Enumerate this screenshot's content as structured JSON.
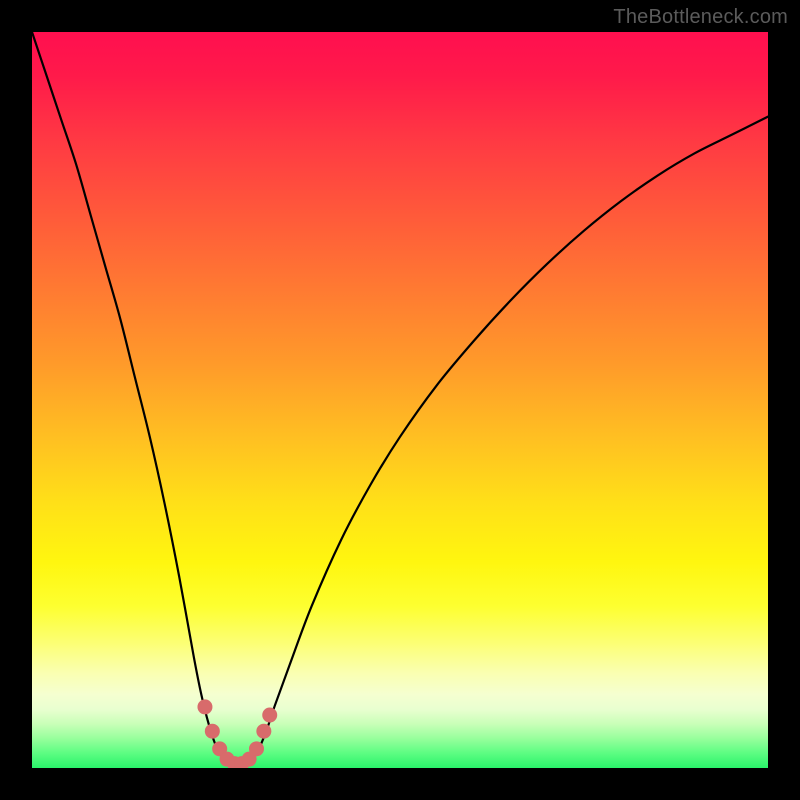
{
  "watermark": "TheBottleneck.com",
  "chart_data": {
    "type": "line",
    "title": "",
    "xlabel": "",
    "ylabel": "",
    "xlim": [
      0,
      100
    ],
    "ylim": [
      0,
      100
    ],
    "series": [
      {
        "name": "curve",
        "x": [
          0,
          2,
          4,
          6,
          8,
          10,
          12,
          14,
          16,
          18,
          20,
          22,
          23,
          24,
          25,
          26,
          27,
          28,
          29,
          30,
          31,
          32,
          33,
          35,
          38,
          42,
          46,
          50,
          55,
          60,
          65,
          70,
          75,
          80,
          85,
          90,
          95,
          100
        ],
        "y": [
          100,
          94,
          88,
          82,
          75,
          68,
          61,
          53,
          45,
          36,
          26,
          15,
          10,
          6,
          3,
          1.4,
          0.7,
          0.5,
          0.7,
          1.4,
          3,
          5.5,
          8.5,
          14,
          22,
          31,
          38.5,
          45,
          52,
          58,
          63.5,
          68.5,
          73,
          77,
          80.5,
          83.5,
          86,
          88.5
        ]
      }
    ],
    "markers": {
      "name": "dots",
      "color": "#d86b6b",
      "x": [
        23.5,
        24.5,
        25.5,
        26.5,
        27.5,
        28.5,
        29.5,
        30.5,
        31.5,
        32.3
      ],
      "y": [
        8.3,
        5.0,
        2.6,
        1.2,
        0.6,
        0.6,
        1.2,
        2.6,
        5.0,
        7.2
      ]
    },
    "background": {
      "type": "vertical-gradient",
      "stops": [
        {
          "pos": 0.0,
          "color": "#ff0f4f"
        },
        {
          "pos": 0.5,
          "color": "#ffaa26"
        },
        {
          "pos": 0.78,
          "color": "#fcff74"
        },
        {
          "pos": 1.0,
          "color": "#2af36a"
        }
      ]
    }
  }
}
